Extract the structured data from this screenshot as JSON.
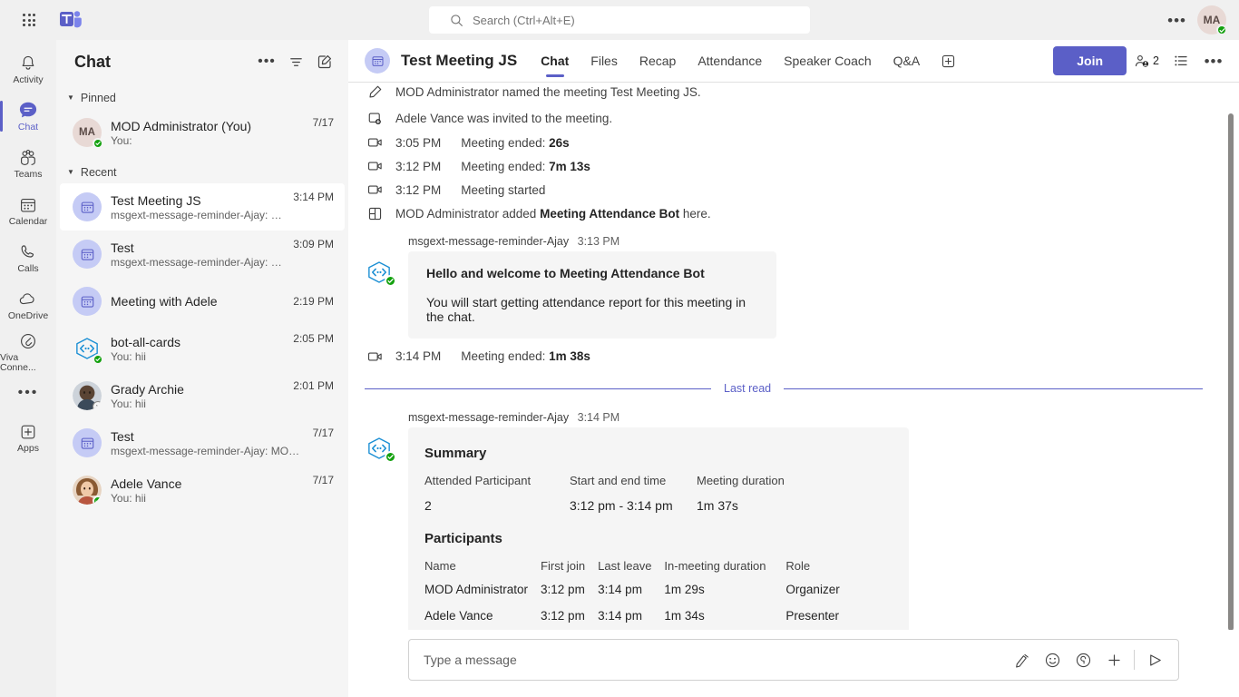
{
  "topbar": {
    "waffle_icon": "app-launcher-icon",
    "logo_icon": "teams-logo-icon",
    "search": {
      "placeholder": "Search (Ctrl+Alt+E)",
      "icon": "search-icon"
    },
    "more_label": "•••",
    "avatar_initials": "MA",
    "presence": "available"
  },
  "rail": {
    "items": [
      {
        "label": "Activity",
        "icon": "bell-icon",
        "active": false
      },
      {
        "label": "Chat",
        "icon": "chat-bubble-icon",
        "active": true
      },
      {
        "label": "Teams",
        "icon": "teams-people-icon",
        "active": false
      },
      {
        "label": "Calendar",
        "icon": "calendar-icon",
        "active": false
      },
      {
        "label": "Calls",
        "icon": "phone-icon",
        "active": false
      },
      {
        "label": "OneDrive",
        "icon": "cloud-icon",
        "active": false
      },
      {
        "label": "Viva Conne...",
        "icon": "viva-connections-icon",
        "active": false
      }
    ],
    "more_label": "•••",
    "apps": {
      "label": "Apps",
      "icon": "plus-box-icon"
    }
  },
  "chatlist": {
    "title": "Chat",
    "actions": [
      {
        "name": "more-options",
        "label": "•••"
      },
      {
        "name": "filter",
        "label": ""
      },
      {
        "name": "new-chat",
        "label": ""
      }
    ],
    "groups": [
      {
        "name": "Pinned",
        "expanded": true
      },
      {
        "name": "Recent",
        "expanded": true
      }
    ],
    "pinned": [
      {
        "name": "MOD Administrator (You)",
        "preview": "You:",
        "time": "7/17",
        "avatar_type": "initials",
        "initials": "MA",
        "presence": "online",
        "selected": false
      }
    ],
    "recent": [
      {
        "name": "Test Meeting JS",
        "preview": "msgext-message-reminder-Ajay: Sent a card",
        "time": "3:14 PM",
        "avatar_type": "meeting",
        "presence": "none",
        "selected": true
      },
      {
        "name": "Test",
        "preview": "msgext-message-reminder-Ajay: Sent a card",
        "time": "3:09 PM",
        "avatar_type": "meeting",
        "presence": "none",
        "selected": false
      },
      {
        "name": "Meeting with Adele",
        "preview": "",
        "time": "2:19 PM",
        "avatar_type": "meeting",
        "presence": "none",
        "selected": false
      },
      {
        "name": "bot-all-cards",
        "preview": "You: hii",
        "time": "2:05 PM",
        "avatar_type": "bot",
        "presence": "online",
        "selected": false
      },
      {
        "name": "Grady Archie",
        "preview": "You: hii",
        "time": "2:01 PM",
        "avatar_type": "photo-grady",
        "presence": "offline",
        "selected": false
      },
      {
        "name": "Test",
        "preview": "msgext-message-reminder-Ajay: MOD Administra...",
        "time": "7/17",
        "avatar_type": "meeting",
        "presence": "none",
        "selected": false
      },
      {
        "name": "Adele Vance",
        "preview": "You: hii",
        "time": "7/17",
        "avatar_type": "photo-adele",
        "presence": "online",
        "selected": false
      }
    ]
  },
  "main_header": {
    "avatar_icon": "meeting-calendar-icon",
    "title": "Test Meeting JS",
    "tabs": [
      {
        "label": "Chat",
        "active": true
      },
      {
        "label": "Files",
        "active": false
      },
      {
        "label": "Recap",
        "active": false
      },
      {
        "label": "Attendance",
        "active": false
      },
      {
        "label": "Speaker Coach",
        "active": false
      },
      {
        "label": "Q&A",
        "active": false
      }
    ],
    "add_tab_icon": "plus-box-icon",
    "join_label": "Join",
    "people_count": "2",
    "people_icon": "people-icon",
    "roster_icon": "list-icon",
    "more_label": "•••"
  },
  "messages": {
    "system": [
      {
        "icon": "pencil-icon",
        "time": "",
        "text_before": "MOD Administrator named the meeting ",
        "bold": "",
        "text_after": "Test Meeting JS."
      },
      {
        "icon": "person-add-icon",
        "time": "",
        "text_before": "Adele Vance was invited to the meeting.",
        "bold": "",
        "text_after": ""
      },
      {
        "icon": "video-icon",
        "time": "3:05 PM",
        "text_before": "Meeting ended: ",
        "bold": "26s",
        "text_after": ""
      },
      {
        "icon": "video-icon",
        "time": "3:12 PM",
        "text_before": "Meeting ended: ",
        "bold": "7m 13s",
        "text_after": ""
      },
      {
        "icon": "video-icon",
        "time": "3:12 PM",
        "text_before": "Meeting started",
        "bold": "",
        "text_after": ""
      },
      {
        "icon": "app-add-icon",
        "time": "",
        "text_before": "MOD Administrator added ",
        "bold": "Meeting Attendance Bot",
        "text_after": " here."
      }
    ],
    "welcome_message": {
      "sender": "msgext-message-reminder-Ajay",
      "time": "3:13 PM",
      "avatar_icon": "bot-code-icon",
      "title": "Hello and welcome to Meeting Attendance Bot",
      "text": "You will start getting attendance report for this meeting in the chat."
    },
    "meeting_ended": {
      "icon": "video-icon",
      "time": "3:14 PM",
      "text_before": "Meeting ended: ",
      "bold": "1m 38s",
      "text_after": ""
    },
    "last_read_label": "Last read",
    "summary_message": {
      "sender": "msgext-message-reminder-Ajay",
      "time": "3:14 PM",
      "avatar_icon": "bot-code-icon",
      "summary_title": "Summary",
      "summary_headers": [
        "Attended Participant",
        "Start and end time",
        "Meeting duration"
      ],
      "summary_values": [
        "2",
        "3:12 pm - 3:14 pm",
        "1m 37s"
      ],
      "participants_title": "Participants",
      "participants_headers": [
        "Name",
        "First join",
        "Last leave",
        "In-meeting duration",
        "Role"
      ],
      "participants_rows": [
        [
          "MOD Administrator",
          "3:12 pm",
          "3:14 pm",
          "1m 29s",
          "Organizer"
        ],
        [
          "Adele Vance",
          "3:12 pm",
          "3:14 pm",
          "1m 34s",
          "Presenter"
        ]
      ]
    }
  },
  "compose": {
    "placeholder": "Type a message",
    "icons": [
      {
        "name": "format-icon"
      },
      {
        "name": "emoji-icon"
      },
      {
        "name": "giphy-icon"
      },
      {
        "name": "plus-icon"
      },
      {
        "name": "send-icon"
      }
    ]
  },
  "colors": {
    "accent": "#5b5fc7",
    "presence_green": "#13a10e",
    "card_bg": "#f5f5f5",
    "panel_bg": "#f5f5f5",
    "chrome_bg": "#f0f0f0"
  }
}
